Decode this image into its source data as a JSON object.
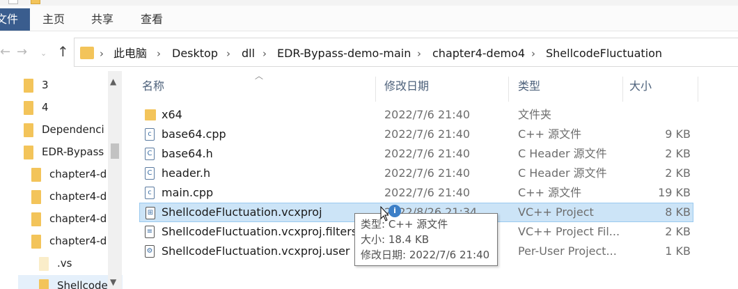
{
  "ribbon": {
    "file_tab": "文件",
    "tabs": [
      "主页",
      "共享",
      "查看"
    ]
  },
  "address": {
    "breadcrumbs": [
      "此电脑",
      "Desktop",
      "dll",
      "EDR-Bypass-demo-main",
      "chapter4-demo4",
      "ShellcodeFluctuation"
    ]
  },
  "nav_tree": [
    {
      "label": "3"
    },
    {
      "label": "4"
    },
    {
      "label": "Dependenci"
    },
    {
      "label": "EDR-Bypass"
    },
    {
      "label": "chapter4-d"
    },
    {
      "label": "chapter4-d"
    },
    {
      "label": "chapter4-d"
    },
    {
      "label": "chapter4-d"
    },
    {
      "label": ".vs"
    },
    {
      "label": "Shellcode"
    }
  ],
  "columns": {
    "name": "名称",
    "date": "修改日期",
    "type": "类型",
    "size": "大小"
  },
  "files": [
    {
      "icon": "folder-icon",
      "name": "x64",
      "date": "2022/7/6 21:40",
      "type": "文件夹",
      "size": ""
    },
    {
      "icon": "cpp-file-icon",
      "name": "base64.cpp",
      "date": "2022/7/6 21:40",
      "type": "C++ 源文件",
      "size": "9 KB"
    },
    {
      "icon": "header-file-icon",
      "name": "base64.h",
      "date": "2022/7/6 21:40",
      "type": "C Header 源文件",
      "size": "2 KB"
    },
    {
      "icon": "header-file-icon",
      "name": "header.h",
      "date": "2022/7/6 21:40",
      "type": "C Header 源文件",
      "size": "2 KB"
    },
    {
      "icon": "cpp-file-icon",
      "name": "main.cpp",
      "date": "2022/7/6 21:40",
      "type": "C++ 源文件",
      "size": "19 KB"
    },
    {
      "icon": "vcxproj-file-icon",
      "name": "ShellcodeFluctuation.vcxproj",
      "date": "2022/8/26 21:34",
      "type": "VC++ Project",
      "size": "8 KB"
    },
    {
      "icon": "filters-file-icon",
      "name": "ShellcodeFluctuation.vcxproj.filters",
      "date": "",
      "type": "VC++ Project Fil...",
      "size": "2 KB"
    },
    {
      "icon": "user-file-icon",
      "name": "ShellcodeFluctuation.vcxproj.user",
      "date": "",
      "type": "Per-User Project...",
      "size": "1 KB"
    }
  ],
  "tooltip": {
    "type_line": "类型: C++ 源文件",
    "size_line": "大小: 18.4 KB",
    "date_line": "修改日期: 2022/7/6 21:40"
  },
  "colors": {
    "file_tab_bg": "#3a5d8e",
    "selection_bg": "#cce4f7",
    "folder": "#f3c45a"
  }
}
